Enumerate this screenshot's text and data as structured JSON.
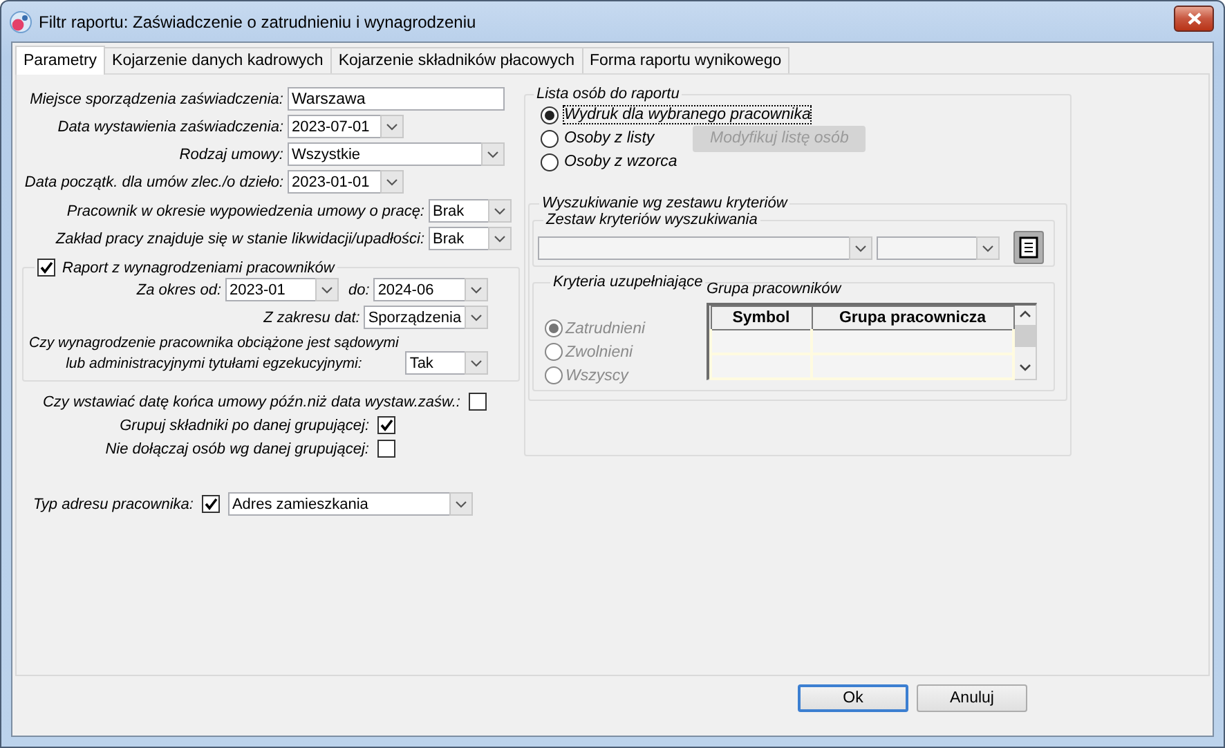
{
  "window": {
    "title": "Filtr raportu: Zaświadczenie o zatrudnieniu i wynagrodzeniu"
  },
  "tabs": [
    {
      "label": "Parametry",
      "selected": true
    },
    {
      "label": "Kojarzenie danych kadrowych",
      "selected": false
    },
    {
      "label": "Kojarzenie składników płacowych",
      "selected": false
    },
    {
      "label": "Forma raportu wynikowego",
      "selected": false
    }
  ],
  "fields": [
    {
      "kind": "text",
      "label": "Miejsce sporządzenia zaświadczenia:",
      "value": "Warszawa"
    },
    {
      "kind": "date",
      "label": "Data wystawienia zaświadczenia:",
      "value": "2023-07-01"
    },
    {
      "kind": "combo",
      "label": "Rodzaj umowy:",
      "value": "Wszystkie"
    },
    {
      "kind": "date",
      "label": "Data początk. dla umów zlec./o dzieło:",
      "value": "2023-01-01"
    },
    {
      "kind": "short",
      "label": "Pracownik w okresie wypowiedzenia umowy o pracę:",
      "value": "Brak"
    },
    {
      "kind": "short",
      "label": "Zakład pracy znajduje się w stanie likwidacji/upadłości:",
      "value": "Brak"
    }
  ],
  "wage_report": {
    "label": "Raport z wynagrodzeniami pracowników",
    "checked": true,
    "period_from": {
      "label": "Za okres od:",
      "value": "2023-01"
    },
    "period_to": {
      "label": "do:",
      "value": "2024-06"
    },
    "date_range": {
      "label": "Z zakresu dat:",
      "value": "Sporządzenia"
    },
    "enforcement": {
      "label": "Czy wynagrodzenie pracownika obciążone jest sądowymi\nlub administracyjnymi tytułami egzekucyjnymi:",
      "value": "Tak"
    }
  },
  "options": [
    {
      "label": "Czy wstawiać datę końca umowy późn.niż data wystaw.zaśw.:",
      "checked": false
    },
    {
      "label": "Grupuj składniki po danej grupującej:",
      "checked": true
    },
    {
      "label": "Nie dołączaj osób wg danej grupującej:",
      "checked": false
    }
  ],
  "address_type": {
    "label": "Typ adresu pracownika:",
    "checked": true,
    "value": "Adres zamieszkania"
  },
  "person_list": {
    "title": "Lista osób do raportu",
    "options": [
      {
        "label": "Wydruk dla wybranego pracownika",
        "selected": true
      },
      {
        "label": "Osoby z listy",
        "selected": false
      },
      {
        "label": "Osoby z wzorca",
        "selected": false
      }
    ],
    "modify_button": {
      "label": "Modyfikuj listę osób",
      "disabled": true
    }
  },
  "search": {
    "title": "Wyszukiwanie wg zestawu kryteriów",
    "criteria_set": {
      "title": "Zestaw kryteriów wyszukiwania"
    },
    "supplementary": {
      "title": "Kryteria uzupełniające",
      "disabled": true,
      "options": [
        {
          "label": "Zatrudnieni",
          "selected": true
        },
        {
          "label": "Zwolnieni",
          "selected": false
        },
        {
          "label": "Wszyscy",
          "selected": false
        }
      ],
      "group_table": {
        "title": "Grupa pracowników",
        "columns": [
          "Symbol",
          "Grupa pracownicza"
        ]
      }
    }
  },
  "buttons": [
    {
      "label": "Ok",
      "default": true
    },
    {
      "label": "Anuluj",
      "default": false
    }
  ]
}
